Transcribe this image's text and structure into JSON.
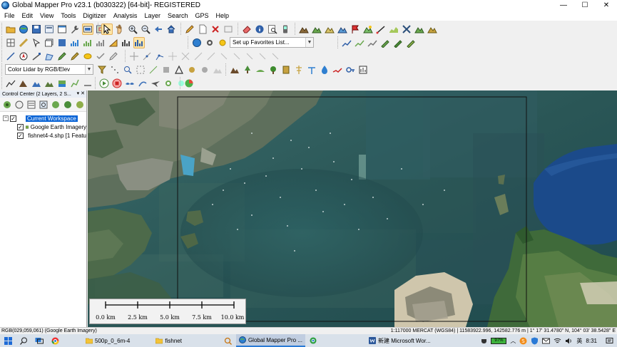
{
  "window": {
    "title": "Global Mapper Pro v23.1 (b030322) [64-bit]- REGISTERED",
    "minimize": "—",
    "maximize": "☐",
    "close": "✕"
  },
  "menu": [
    "File",
    "Edit",
    "View",
    "Tools",
    "Digitizer",
    "Analysis",
    "Layer",
    "Search",
    "GPS",
    "Help"
  ],
  "toolbar": {
    "favorites_combo": "Set up Favorites List...",
    "lidar_color_combo": "Color Lidar by RGB/Elev"
  },
  "control_center": {
    "title": "Control Center (2 Layers, 2 S...",
    "header_buttons": "▾ ✕",
    "workspace": "Current Workspace",
    "layers": [
      {
        "label": "Google Earth Imagery",
        "checked": true,
        "icon": "imagery-layer-icon"
      },
      {
        "label": "fishnet4-4.shp [1 Featu",
        "checked": true,
        "icon": "vector-layer-icon"
      }
    ]
  },
  "map": {
    "scale_labels": [
      "0.0 km",
      "2.5 km",
      "5.0 km",
      "7.5 km",
      "10.0 km"
    ]
  },
  "status": {
    "left": "RGB(029,059,061) (Google Earth Imagery)",
    "right": "1:117000  MERCAT (WGS84) | 11583922.996, 142582.776 m | 1° 17' 31.4780\" N, 104° 03' 38.5428\" E"
  },
  "taskbar": {
    "apps": [
      {
        "label": "500p_0_6m-4",
        "icon": "folder-icon",
        "active": false
      },
      {
        "label": "fishnet",
        "icon": "folder-icon",
        "active": false
      },
      {
        "label": "Global Mapper Pro ...",
        "icon": "globe-icon",
        "active": true
      },
      {
        "label": "",
        "icon": "chrome-icon",
        "active": false
      },
      {
        "label": "新建 Microsoft Wor...",
        "icon": "word-icon",
        "active": false
      }
    ],
    "battery": "97%",
    "ime": "英",
    "time": "8:31",
    "colors": {
      "battery": "#3db33d",
      "accent": "#2a7ad6"
    }
  }
}
